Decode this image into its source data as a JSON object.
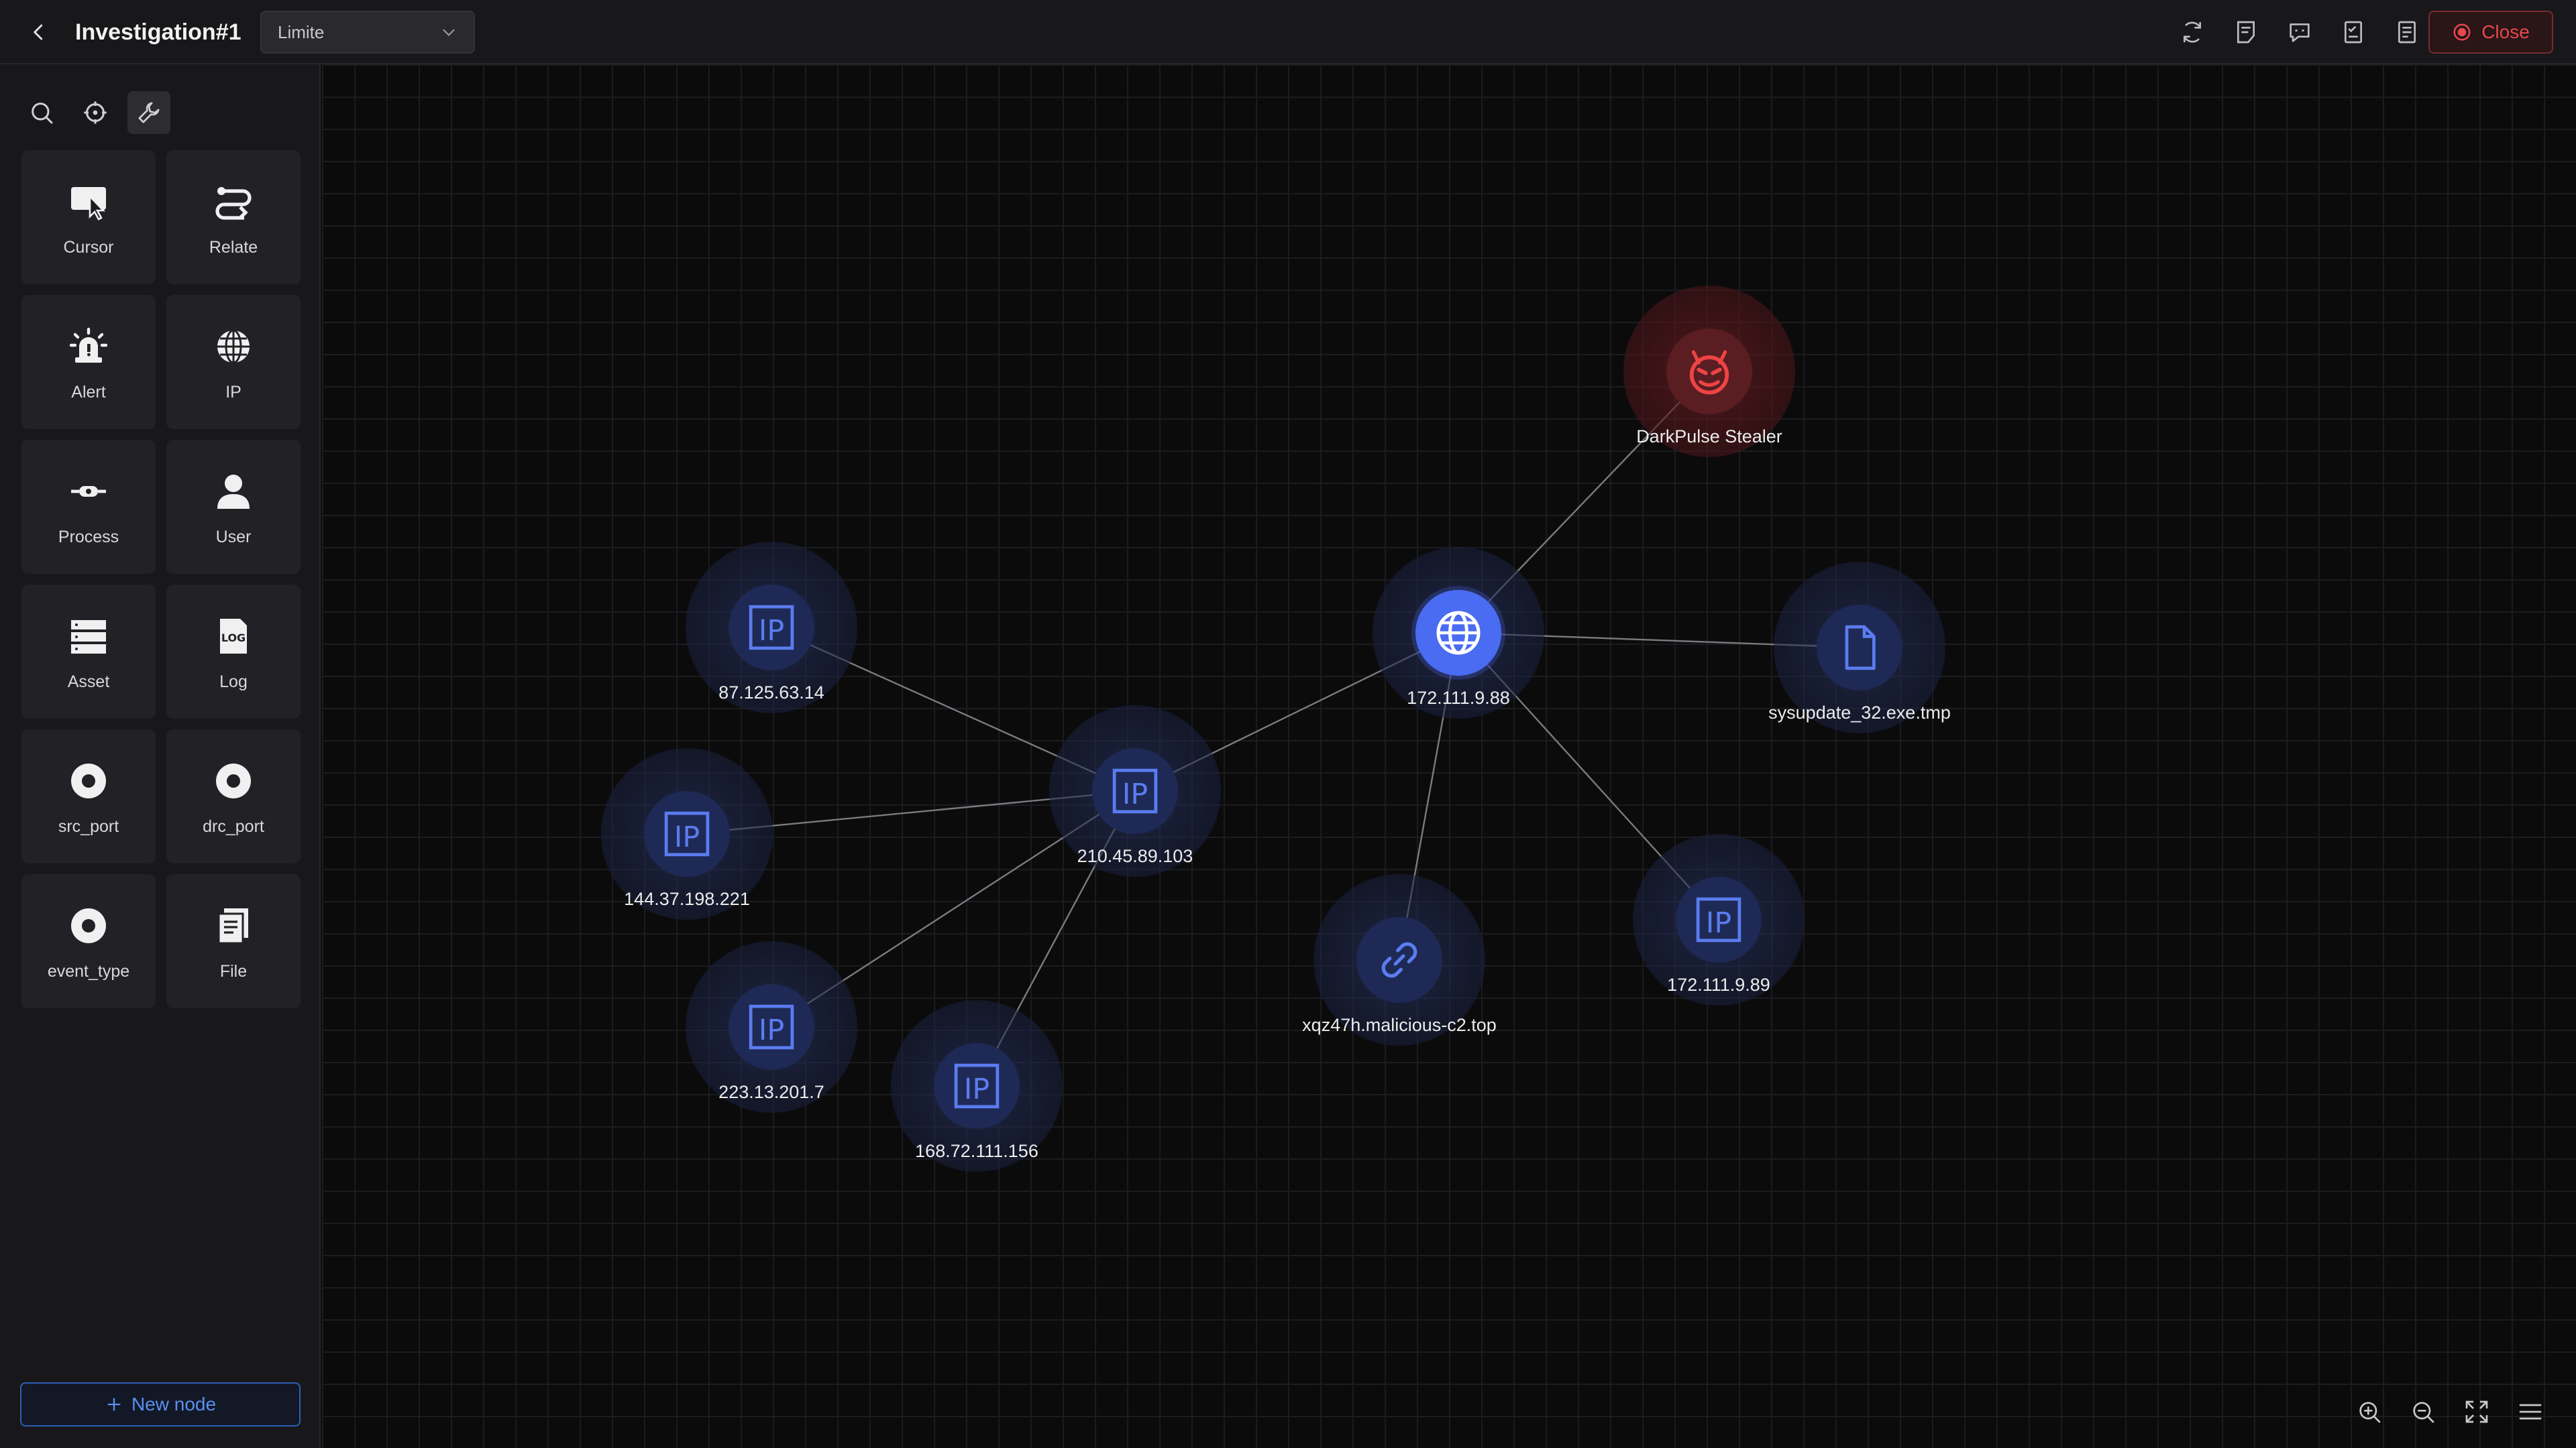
{
  "header": {
    "title": "Investigation#1",
    "mode_select": {
      "value": "Limite"
    },
    "toolbar_icons": [
      "refresh-icon",
      "notes-icon",
      "comment-icon",
      "checklist-icon",
      "report-icon"
    ],
    "close_label": "Close"
  },
  "sidebar": {
    "tabs": [
      "search-icon",
      "target-icon",
      "wrench-icon"
    ],
    "active_tab": "wrench-icon",
    "tools": [
      {
        "label": "Cursor",
        "icon": "cursor-icon"
      },
      {
        "label": "Relate",
        "icon": "relate-icon"
      },
      {
        "label": "Alert",
        "icon": "alert-icon"
      },
      {
        "label": "IP",
        "icon": "globe-icon"
      },
      {
        "label": "Process",
        "icon": "process-icon"
      },
      {
        "label": "User",
        "icon": "user-icon"
      },
      {
        "label": "Asset",
        "icon": "asset-icon"
      },
      {
        "label": "Log",
        "icon": "log-icon"
      },
      {
        "label": "src_port",
        "icon": "port-icon"
      },
      {
        "label": "drc_port",
        "icon": "port-icon"
      },
      {
        "label": "event_type",
        "icon": "port-icon"
      },
      {
        "label": "File",
        "icon": "file-icon"
      }
    ],
    "new_node_label": "New node"
  },
  "graph": {
    "nodes": {
      "darkpulse": {
        "label": "DarkPulse Stealer",
        "type": "malware",
        "icon": "devil-icon"
      },
      "hub": {
        "label": "172.111.9.88",
        "type": "domain",
        "icon": "globe-icon"
      },
      "file": {
        "label": "sysupdate_32.exe.tmp",
        "type": "file",
        "icon": "file-icon"
      },
      "ip_87": {
        "label": "87.125.63.14",
        "type": "ip",
        "icon": "ip-icon"
      },
      "ip_210": {
        "label": "210.45.89.103",
        "type": "ip",
        "icon": "ip-icon"
      },
      "ip_144": {
        "label": "144.37.198.221",
        "type": "ip",
        "icon": "ip-icon"
      },
      "ip_223": {
        "label": "223.13.201.7",
        "type": "ip",
        "icon": "ip-icon"
      },
      "ip_168": {
        "label": "168.72.111.156",
        "type": "ip",
        "icon": "ip-icon"
      },
      "url": {
        "label": "xqz47h.malicious-c2.top",
        "type": "url",
        "icon": "link-icon"
      },
      "ip_172_89": {
        "label": "172.111.9.89",
        "type": "ip",
        "icon": "ip-icon"
      }
    },
    "edges": [
      [
        "hub",
        "darkpulse"
      ],
      [
        "hub",
        "file"
      ],
      [
        "hub",
        "ip_210"
      ],
      [
        "hub",
        "url"
      ],
      [
        "hub",
        "ip_172_89"
      ],
      [
        "ip_210",
        "ip_87"
      ],
      [
        "ip_210",
        "ip_144"
      ],
      [
        "ip_210",
        "ip_223"
      ],
      [
        "ip_210",
        "ip_168"
      ]
    ]
  },
  "bottom_toolbar": [
    "zoom-in-icon",
    "zoom-out-icon",
    "fit-screen-icon",
    "menu-icon"
  ],
  "colors": {
    "accent": "#4a6cf2",
    "danger": "#e5484d",
    "link": "#5b8ff0"
  }
}
